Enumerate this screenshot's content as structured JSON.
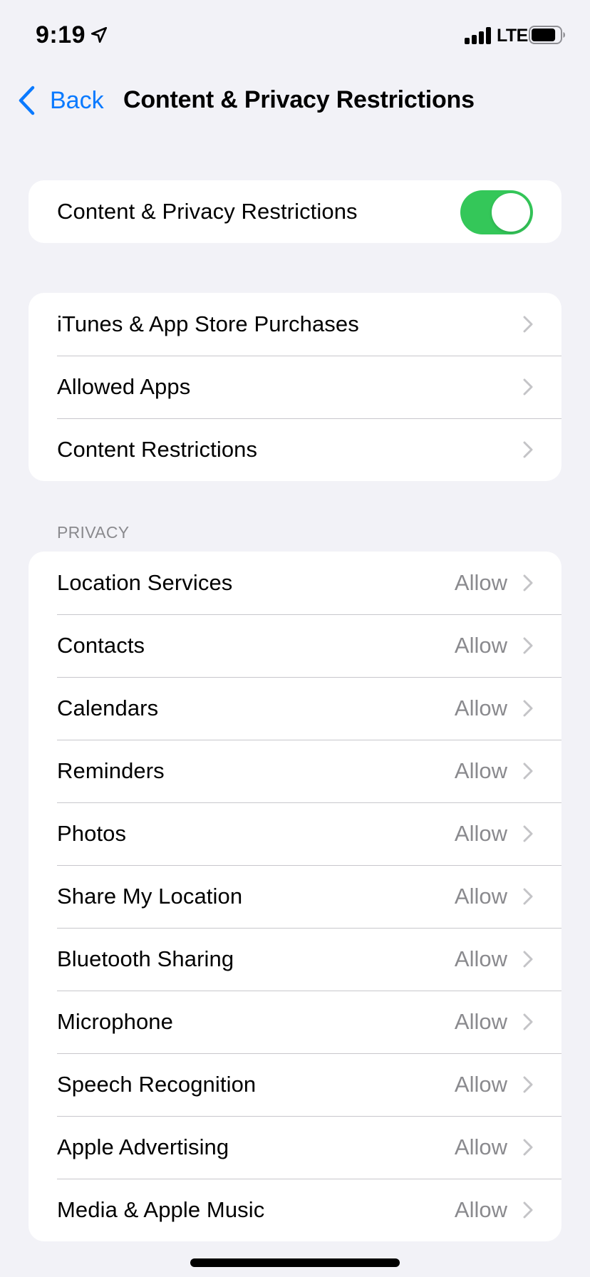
{
  "status_bar": {
    "time": "9:19",
    "location_icon": "location-arrow-icon",
    "signal_icon": "cellular-signal-icon",
    "network": "LTE",
    "battery_icon": "battery-icon",
    "battery_level": 0.85
  },
  "nav": {
    "back_label": "Back",
    "back_icon": "chevron-left-icon",
    "title": "Content & Privacy Restrictions"
  },
  "master_toggle": {
    "label": "Content & Privacy Restrictions",
    "on": true,
    "color": "#34C759"
  },
  "group1": {
    "items": [
      {
        "label": "iTunes & App Store Purchases"
      },
      {
        "label": "Allowed Apps"
      },
      {
        "label": "Content Restrictions"
      }
    ]
  },
  "privacy": {
    "header": "PRIVACY",
    "items": [
      {
        "label": "Location Services",
        "value": "Allow"
      },
      {
        "label": "Contacts",
        "value": "Allow"
      },
      {
        "label": "Calendars",
        "value": "Allow"
      },
      {
        "label": "Reminders",
        "value": "Allow"
      },
      {
        "label": "Photos",
        "value": "Allow"
      },
      {
        "label": "Share My Location",
        "value": "Allow"
      },
      {
        "label": "Bluetooth Sharing",
        "value": "Allow"
      },
      {
        "label": "Microphone",
        "value": "Allow"
      },
      {
        "label": "Speech Recognition",
        "value": "Allow"
      },
      {
        "label": "Apple Advertising",
        "value": "Allow"
      },
      {
        "label": "Media & Apple Music",
        "value": "Allow"
      }
    ]
  },
  "colors": {
    "accent": "#0A7AFF",
    "background": "#F2F2F7",
    "secondary_text": "#8A8A8E",
    "chevron": "#C4C4C7"
  }
}
